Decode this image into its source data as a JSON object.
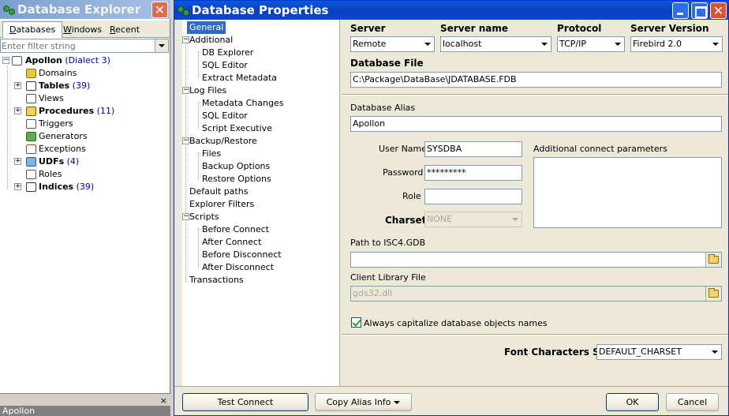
{
  "explorer": {
    "title": "Database Explorer",
    "tabs": [
      {
        "label": "Databases",
        "underline": "D",
        "rest": "atabases"
      },
      {
        "label": "Windows",
        "underline": "W",
        "rest": "indows"
      },
      {
        "label": "Recent",
        "underline": "R",
        "rest": "ecent"
      }
    ],
    "filter_placeholder": "Enter filter string",
    "tree": {
      "root_label": "Apollon",
      "root_dialect": "(Dialect 3)",
      "nodes": [
        {
          "label": "Domains",
          "count": "",
          "bold": false
        },
        {
          "label": "Tables",
          "count": "(39)",
          "bold": true
        },
        {
          "label": "Views",
          "count": "",
          "bold": false
        },
        {
          "label": "Procedures",
          "count": "(11)",
          "bold": true
        },
        {
          "label": "Triggers",
          "count": "",
          "bold": false
        },
        {
          "label": "Generators",
          "count": "",
          "bold": false
        },
        {
          "label": "Exceptions",
          "count": "",
          "bold": false
        },
        {
          "label": "UDFs",
          "count": "(4)",
          "bold": true
        },
        {
          "label": "Roles",
          "count": "",
          "bold": false
        },
        {
          "label": "Indices",
          "count": "(39)",
          "bold": true
        }
      ]
    },
    "bottom_close": "×",
    "bottom_label": "Apollon"
  },
  "dialog": {
    "title": "Database Properties",
    "nav": {
      "general": "General",
      "additional": "Additional",
      "additional_children": [
        "DB Explorer",
        "SQL Editor",
        "Extract Metadata"
      ],
      "log_files": "Log Files",
      "log_children": [
        "Metadata Changes",
        "SQL Editor",
        "Script Executive"
      ],
      "backup_restore": "Backup/Restore",
      "backup_children": [
        "Files",
        "Backup Options",
        "Restore Options"
      ],
      "default_paths": "Default paths",
      "explorer_filters": "Explorer Filters",
      "scripts": "Scripts",
      "script_children": [
        "Before Connect",
        "After Connect",
        "Before Disconnect",
        "After Disconnect"
      ],
      "transactions": "Transactions"
    },
    "form": {
      "server_label": "Server",
      "server_value": "Remote",
      "server_name_label": "Server name",
      "server_name_value": "localhost",
      "protocol_label": "Protocol",
      "protocol_value": "TCP/IP",
      "server_version_label": "Server Version",
      "server_version_value": "Firebird 2.0",
      "db_file_label": "Database File",
      "db_file_value": "C:\\Package\\DataBase\\JDATABASE.FDB",
      "alias_label": "Database Alias",
      "alias_value": "Apollon",
      "user_name_label": "User Name",
      "user_name_value": "SYSDBA",
      "password_label": "Password",
      "password_value": "*********",
      "role_label": "Role",
      "role_value": "",
      "charset_label": "Charset",
      "charset_value": "NONE",
      "additional_params_label": "Additional connect parameters",
      "isc4_label": "Path to ISC4.GDB",
      "isc4_value": "",
      "client_lib_label": "Client Library File",
      "client_lib_value": "gds32.dll",
      "capitalize_label": "Always capitalize database objects names",
      "capitalize_checked": true,
      "font_charset_label": "Font Characters Set",
      "font_charset_value": "DEFAULT_CHARSET"
    },
    "buttons": {
      "test_connect": "Test Connect",
      "copy_alias": "Copy Alias Info",
      "ok": "OK",
      "cancel": "Cancel"
    }
  }
}
